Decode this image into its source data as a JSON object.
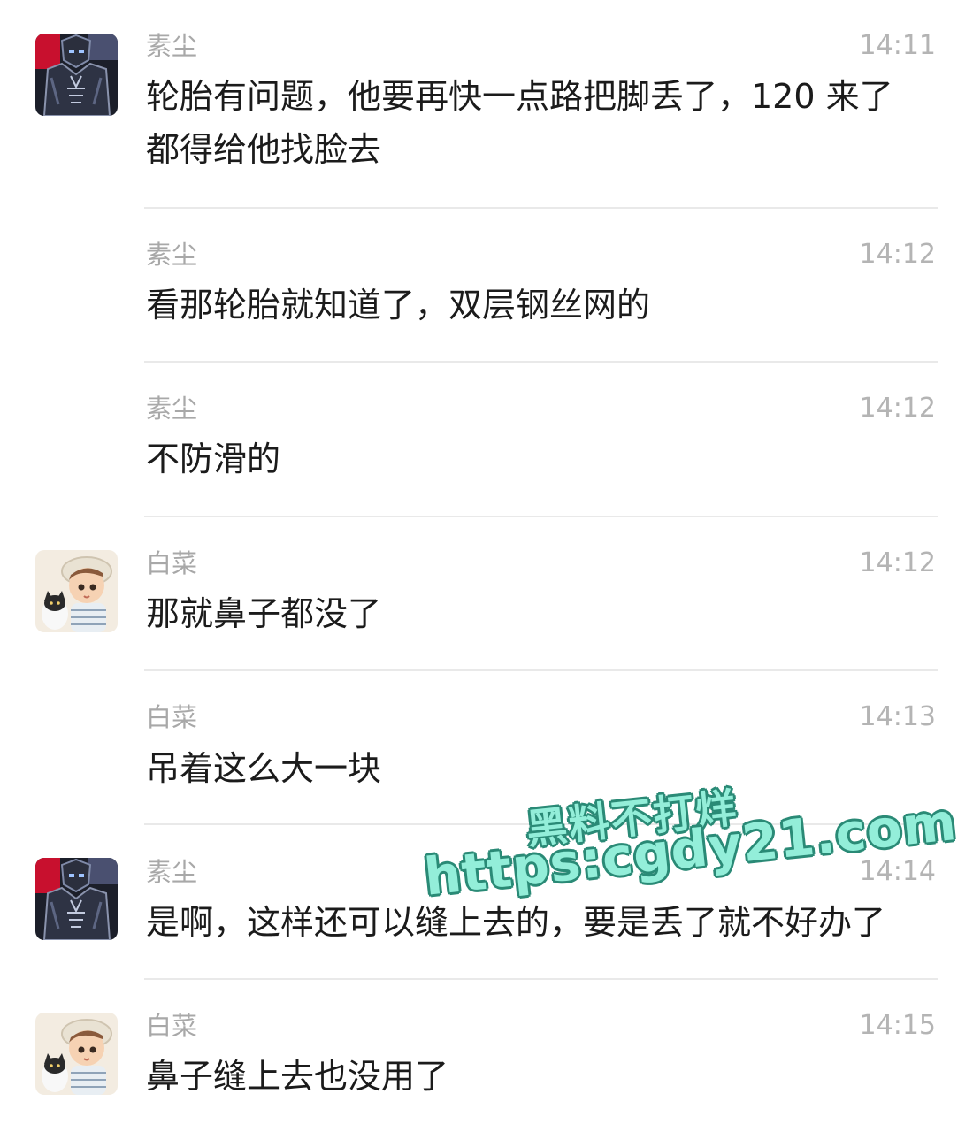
{
  "messages": [
    {
      "sender": "素尘",
      "time": "14:11",
      "lines": [
        "轮胎有问题，他要再快一点路把脚丢了，120 来了",
        "都得给他找脸去"
      ],
      "avatar": "robot-avatar-icon"
    },
    {
      "sender": "素尘",
      "time": "14:12",
      "lines": [
        "看那轮胎就知道了，双层钢丝网的"
      ]
    },
    {
      "sender": "素尘",
      "time": "14:12",
      "lines": [
        "不防滑的"
      ]
    },
    {
      "sender": "白菜",
      "time": "14:12",
      "lines": [
        "那就鼻子都没了"
      ],
      "avatar": "boy-with-cat-avatar-icon"
    },
    {
      "sender": "白菜",
      "time": "14:13",
      "lines": [
        "吊着这么大一块"
      ]
    },
    {
      "sender": "素尘",
      "time": "14:14",
      "lines": [
        "是啊，这样还可以缝上去的，要是丢了就不好办了"
      ],
      "avatar": "robot-avatar-icon"
    },
    {
      "sender": "白菜",
      "time": "14:15",
      "lines": [
        "鼻子缝上去也没用了"
      ],
      "avatar": "boy-with-cat-avatar-icon"
    }
  ],
  "watermark": {
    "line1": "黑料不打烊",
    "line2": "https:cgdy21.com"
  },
  "colors": {
    "name": "#a8a8a8",
    "time": "#b4b4b4",
    "text": "#1b1b1b",
    "divider": "#e9e9e9",
    "watermark_fill": "#93eed9",
    "watermark_stroke": "#2a8a76"
  }
}
